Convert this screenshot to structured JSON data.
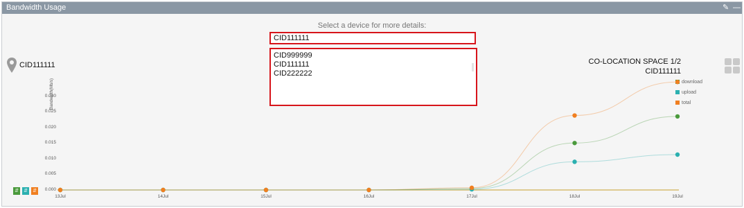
{
  "panel": {
    "title": "Bandwidth Usage",
    "icons": [
      "pin-icon",
      "minimize-icon"
    ]
  },
  "prompt": "Select a device for more details:",
  "selector": {
    "selected": "CID111111",
    "options": [
      "CID999999",
      "CID111111",
      "CID222222"
    ]
  },
  "left_device": "CID111111",
  "location": {
    "name": "CO-LOCATION SPACE 1/2",
    "cid": "CID111111"
  },
  "colors": {
    "download": "#4a9a3c",
    "upload": "#2bb0b0",
    "total": "#f07f20",
    "highlight": "#d7141a",
    "header": "#8a97a4"
  },
  "chart_data": {
    "type": "line",
    "ylabel": "Bandwidth(Mb/s)",
    "ylim": [
      0,
      0.035
    ],
    "yticks": [
      "0.000",
      "0.005",
      "0.010",
      "0.015",
      "0.020",
      "0.025",
      "0.030"
    ],
    "categories": [
      "13Jul",
      "14Jul",
      "15Jul",
      "16Jul",
      "17Jul",
      "18Jul",
      "19Jul"
    ],
    "series": [
      {
        "name": "download",
        "values": [
          0,
          0,
          0,
          0,
          0.0005,
          0.015,
          0.0235
        ]
      },
      {
        "name": "upload",
        "values": [
          0,
          0,
          0,
          0,
          0.0002,
          0.009,
          0.0113
        ]
      },
      {
        "name": "total",
        "values": [
          0,
          0,
          0,
          0,
          0.0007,
          0.0238,
          0.0345
        ]
      }
    ],
    "legend": "top-right",
    "grid": false
  }
}
